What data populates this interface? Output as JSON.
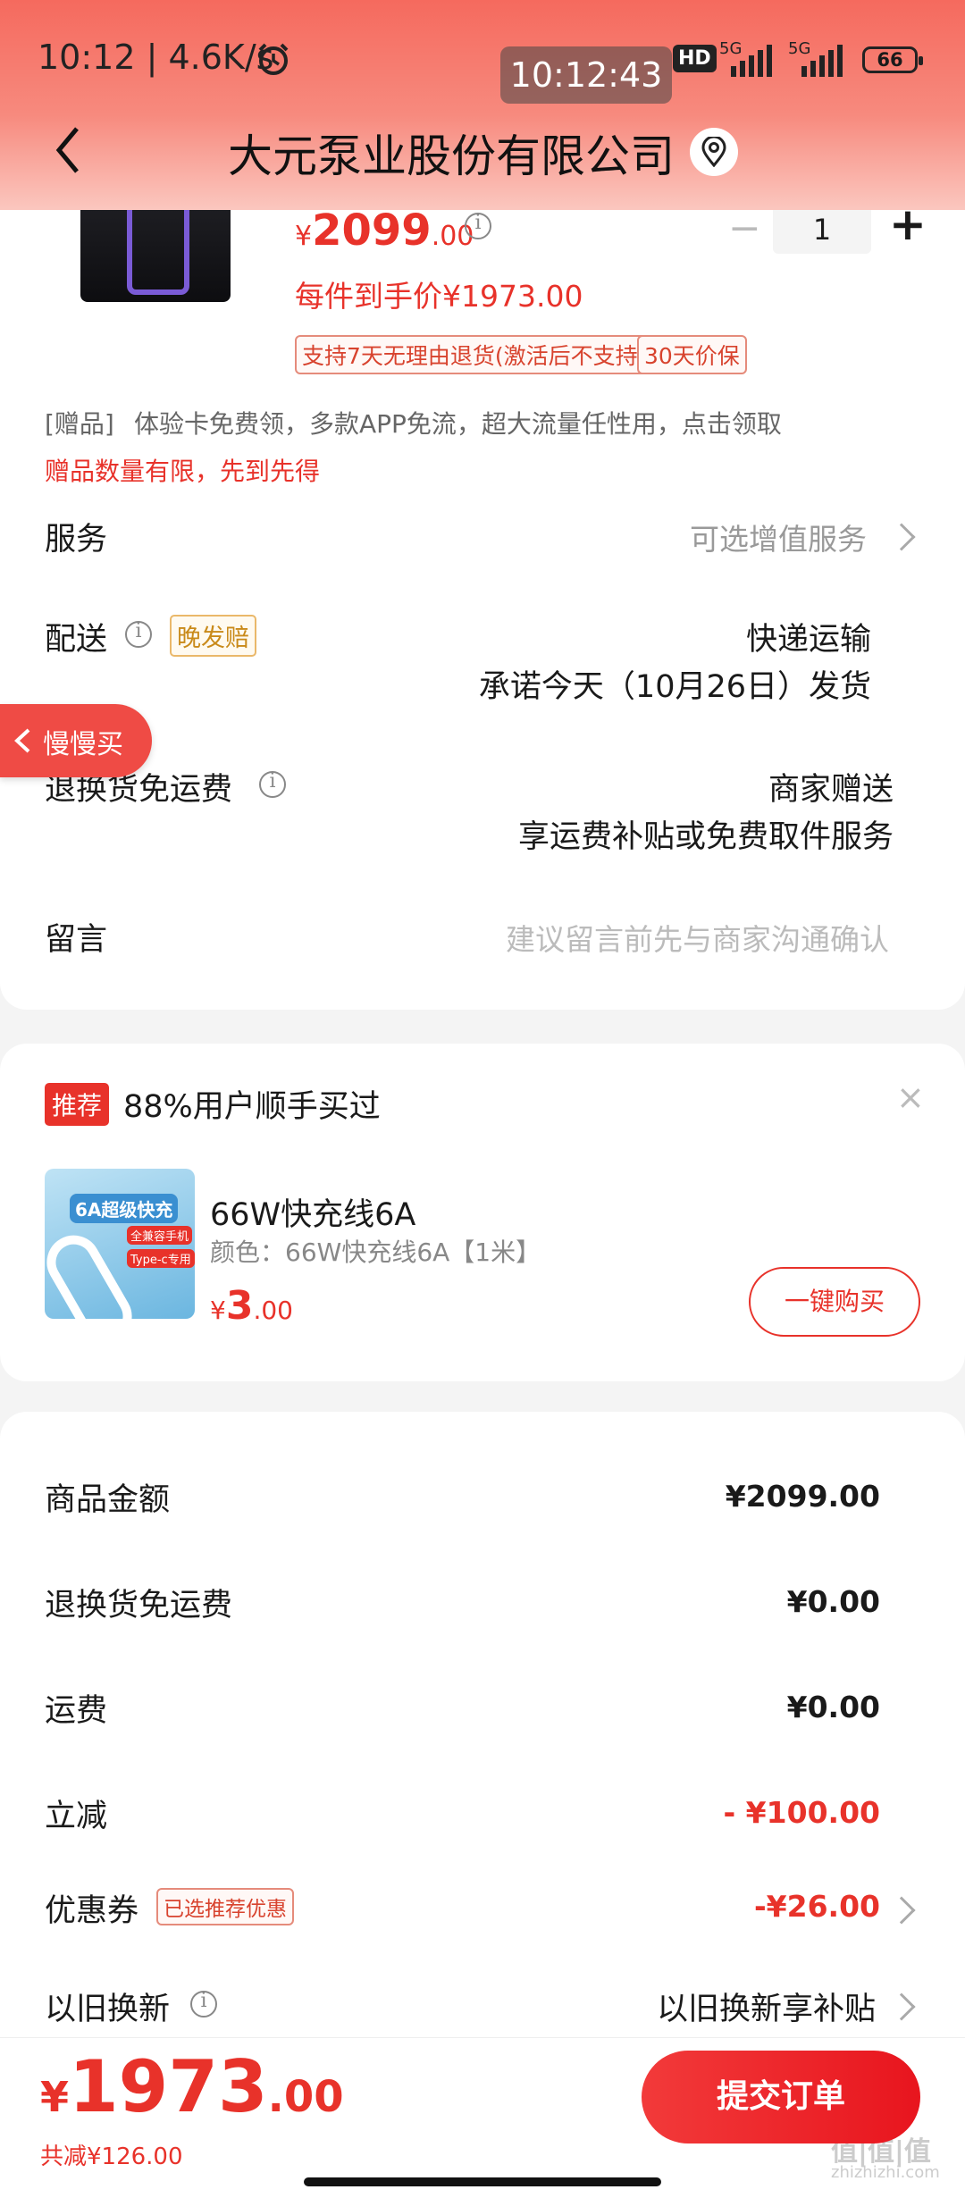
{
  "status_bar": {
    "time": "10:12 | 4.6K/s",
    "clock_toast": "10:12:43",
    "hd": "HD",
    "net1": "5G",
    "net2": "5G",
    "battery": "66"
  },
  "header": {
    "title": "大元泵业股份有限公司"
  },
  "product": {
    "price_symbol": "¥",
    "price_int": "2099",
    "price_dec": ".00",
    "qty": "1",
    "minus": "−",
    "plus": "+",
    "net_price": "每件到手价¥1973.00",
    "tag1": "支持7天无理由退货(激活后不支持)",
    "tag2": "30天价保",
    "gift_label": "[赠品]",
    "gift_text": "体验卡免费领，多款APP免流，超大流量任性用，点击领取",
    "gift_note": "赠品数量有限，先到先得"
  },
  "service": {
    "label": "服务",
    "value": "可选增值服务"
  },
  "delivery": {
    "label": "配送",
    "badge": "晚发赔",
    "line1": "快递运输",
    "line2": "承诺今天（10月26日）发货"
  },
  "floating": {
    "label": "慢慢买"
  },
  "return_fee": {
    "label": "退换货免运费",
    "line1": "商家赠送",
    "line2": "享运费补贴或免费取件服务"
  },
  "message": {
    "label": "留言",
    "placeholder": "建议留言前先与商家沟通确认"
  },
  "recommend": {
    "tag": "推荐",
    "headline": "88%用户顺手买过",
    "close": "×",
    "thumb_badge": "6A超级快充",
    "thumb_sub1": "全兼容手机",
    "thumb_sub2": "Type-c专用",
    "name": "66W快充线6A",
    "spec": "颜色：66W快充线6A【1米】",
    "price_symbol": "¥",
    "price_int": "3",
    "price_dec": ".00",
    "button": "一键购买"
  },
  "summary": {
    "rows": [
      {
        "label": "商品金额",
        "value": "¥2099.00"
      },
      {
        "label": "退换货免运费",
        "value": "¥0.00"
      },
      {
        "label": "运费",
        "value": "¥0.00"
      },
      {
        "label": "立减",
        "value": "- ¥100.00"
      },
      {
        "label": "优惠券",
        "value": "-¥26.00",
        "badge": "已选推荐优惠"
      },
      {
        "label": "以旧换新",
        "value": "以旧换新享补贴"
      }
    ]
  },
  "footer": {
    "symbol": "¥",
    "total_int": "1973",
    "total_dec": ".00",
    "saved": "共减¥126.00",
    "submit": "提交订单"
  },
  "watermark": {
    "text": "值|值|值",
    "url": "zhizhizhi.com"
  }
}
